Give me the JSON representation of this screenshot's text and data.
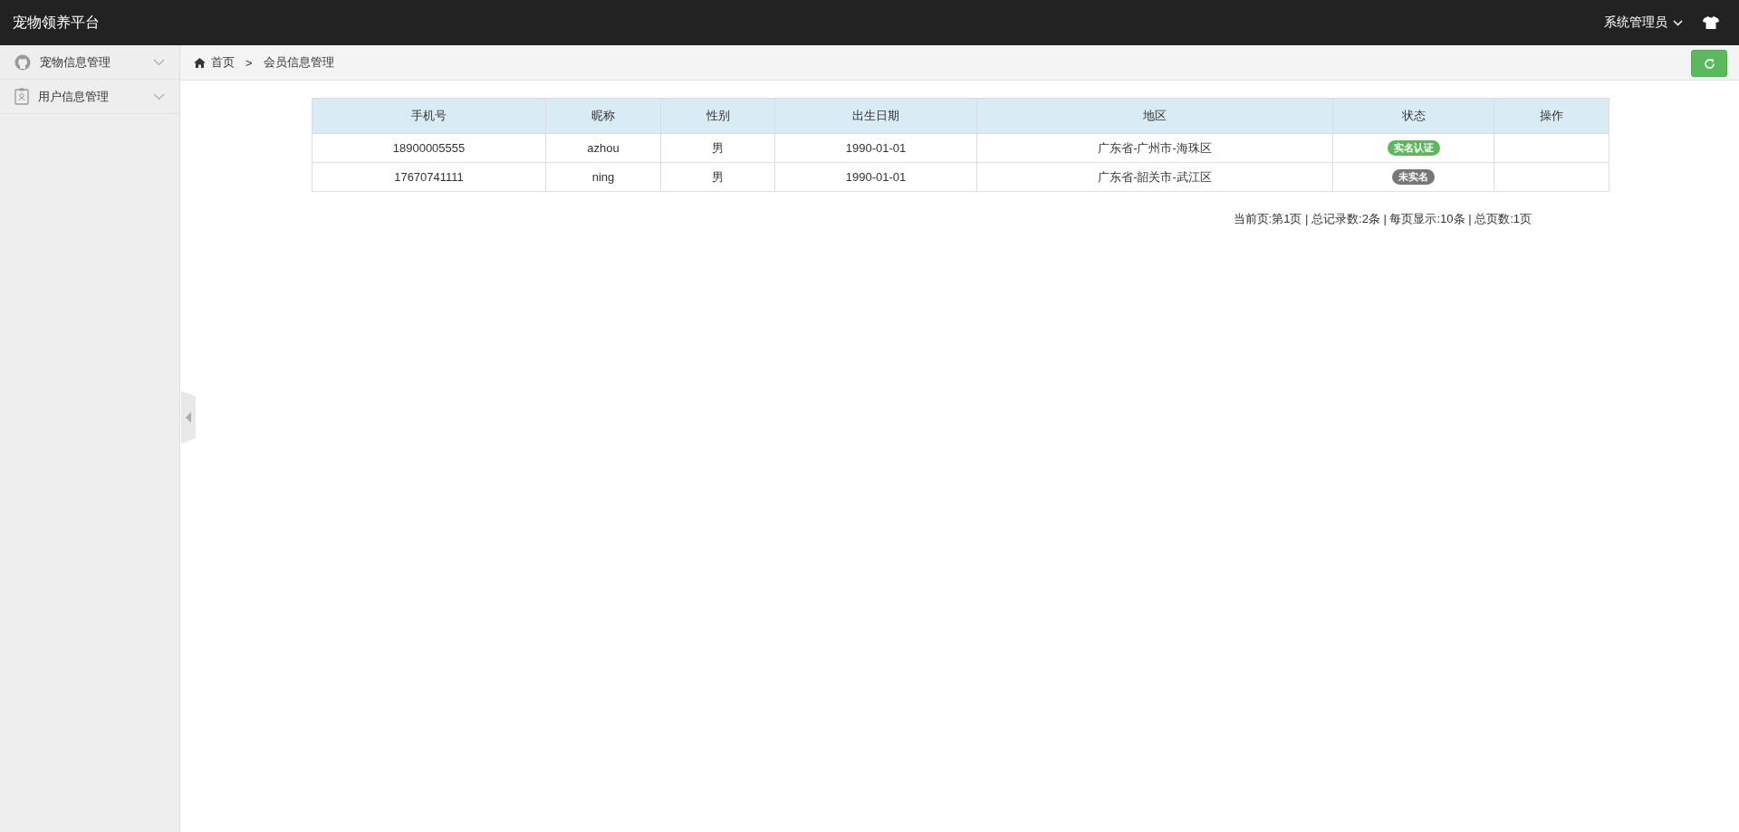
{
  "header": {
    "title": "宠物领养平台",
    "user": "系统管理员"
  },
  "sidebar": {
    "items": [
      {
        "label": "宠物信息管理",
        "expanded": false
      },
      {
        "label": "用户信息管理",
        "expanded": false
      }
    ]
  },
  "breadcrumb": {
    "home": "首页",
    "separator": ">",
    "current": "会员信息管理"
  },
  "table": {
    "columns": [
      "手机号",
      "昵称",
      "性别",
      "出生日期",
      "地区",
      "状态",
      "操作"
    ],
    "rows": [
      {
        "phone": "18900005555",
        "nickname": "azhou",
        "gender": "男",
        "birth": "1990-01-01",
        "region": "广东省-广州市-海珠区",
        "status": {
          "label": "实名认证",
          "kind": "verified"
        }
      },
      {
        "phone": "17670741111",
        "nickname": "ning",
        "gender": "男",
        "birth": "1990-01-01",
        "region": "广东省-韶关市-武江区",
        "status": {
          "label": "未实名",
          "kind": "unverified"
        }
      }
    ]
  },
  "pagination": "当前页:第1页 | 总记录数:2条 | 每页显示:10条 | 总页数:1页"
}
